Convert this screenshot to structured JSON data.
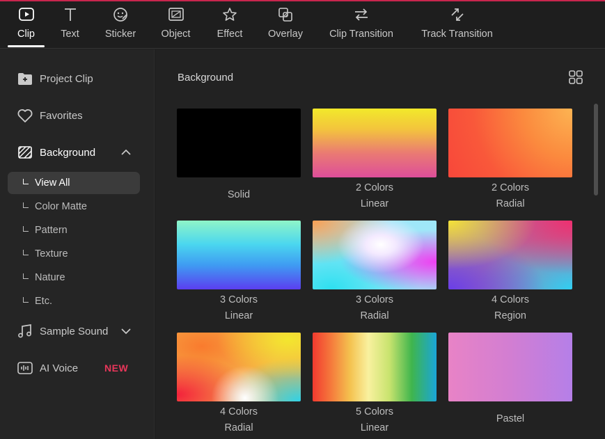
{
  "toolbar": {
    "tabs": [
      {
        "label": "Clip",
        "icon": "clip-play-icon"
      },
      {
        "label": "Text",
        "icon": "text-t-icon"
      },
      {
        "label": "Sticker",
        "icon": "sticker-smile-icon"
      },
      {
        "label": "Object",
        "icon": "object-icon"
      },
      {
        "label": "Effect",
        "icon": "effect-star-icon"
      },
      {
        "label": "Overlay",
        "icon": "overlay-icon"
      },
      {
        "label": "Clip Transition",
        "icon": "clip-transition-icon"
      },
      {
        "label": "Track Transition",
        "icon": "track-transition-icon"
      }
    ],
    "active_tab": "Clip"
  },
  "sidebar": {
    "project_clip": "Project Clip",
    "favorites": "Favorites",
    "background": "Background",
    "sub_items": [
      "View All",
      "Color Matte",
      "Pattern",
      "Texture",
      "Nature",
      "Etc."
    ],
    "active_sub_item": "View All",
    "sample_sound": "Sample Sound",
    "ai_voice": "AI Voice",
    "ai_voice_badge": "NEW"
  },
  "main": {
    "title": "Background",
    "tiles": [
      {
        "line1": "Solid",
        "line2": ""
      },
      {
        "line1": "2 Colors",
        "line2": "Linear"
      },
      {
        "line1": "2 Colors",
        "line2": "Radial"
      },
      {
        "line1": "3 Colors",
        "line2": "Linear"
      },
      {
        "line1": "3 Colors",
        "line2": "Radial"
      },
      {
        "line1": "4 Colors",
        "line2": "Region"
      },
      {
        "line1": "4 Colors",
        "line2": "Radial"
      },
      {
        "line1": "5 Colors",
        "line2": "Linear"
      },
      {
        "line1": "Pastel",
        "line2": ""
      }
    ]
  },
  "colors": {
    "accent": "#c8264e",
    "new_badge": "#e8365a",
    "active_item_bg": "#3b3b3b"
  }
}
